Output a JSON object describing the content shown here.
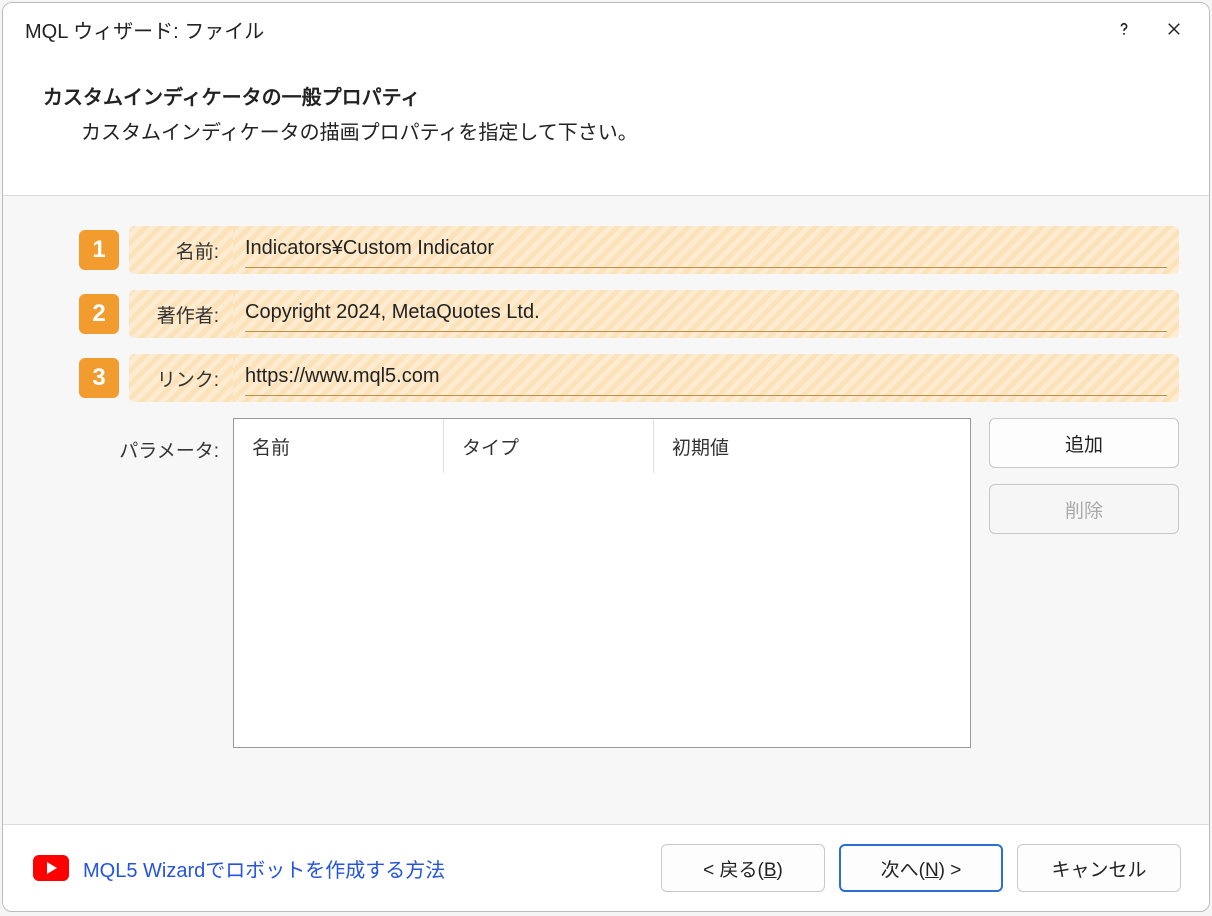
{
  "titlebar": {
    "title": "MQL ウィザード: ファイル"
  },
  "header": {
    "title": "カスタムインディケータの一般プロパティ",
    "subtitle": "カスタムインディケータの描画プロパティを指定して下さい。"
  },
  "form": {
    "markers": {
      "one": "1",
      "two": "2",
      "three": "3"
    },
    "name_label": "名前:",
    "name_value": "Indicators¥Custom Indicator",
    "author_label": "著作者:",
    "author_value": "Copyright 2024, MetaQuotes Ltd.",
    "link_label": "リンク:",
    "link_value": "https://www.mql5.com",
    "params_label": "パラメータ:"
  },
  "table": {
    "col_name": "名前",
    "col_type": "タイプ",
    "col_init": "初期値"
  },
  "buttons": {
    "add": "追加",
    "delete": "削除"
  },
  "footer": {
    "link_text": "MQL5 Wizardでロボットを作成する方法",
    "back_prefix": "< 戻る(",
    "back_key": "B",
    "back_suffix": ")",
    "next_prefix": "次へ(",
    "next_key": "N",
    "next_suffix": ") >",
    "cancel": "キャンセル"
  }
}
